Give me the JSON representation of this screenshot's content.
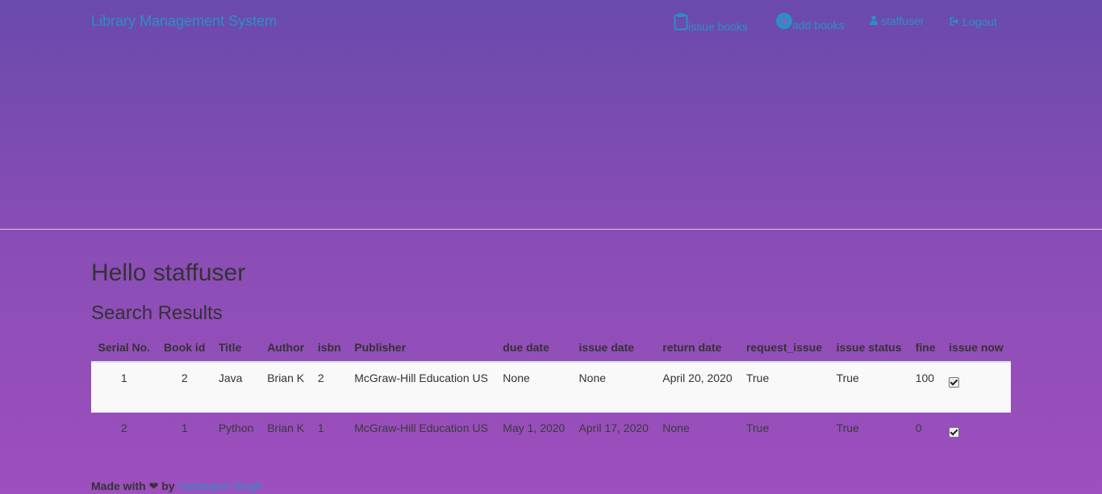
{
  "navbar": {
    "brand": "Library Management System",
    "issue_books": "issue books",
    "add_books": "add books",
    "user": "staffuser",
    "logout": "Logout"
  },
  "main": {
    "greeting": "Hello staffuser",
    "subtitle": "Search Results"
  },
  "table": {
    "headers": [
      "Serial No.",
      "Book id",
      "Title",
      "Author",
      "isbn",
      "Publisher",
      "due date",
      "issue date",
      "return date",
      "request_issue",
      "issue status",
      "fine",
      "issue now"
    ],
    "rows": [
      {
        "serial": "1",
        "book_id": "2",
        "title": "Java",
        "author": "Brian K",
        "isbn": "2",
        "publisher": "McGraw-Hill Education US",
        "due_date": "None",
        "issue_date": "None",
        "return_date": "April 20, 2020",
        "request_issue": "True",
        "issue_status": "True",
        "fine": "100",
        "issue_now": true
      },
      {
        "serial": "2",
        "book_id": "1",
        "title": "Python",
        "author": "Brian K",
        "isbn": "1",
        "publisher": "McGraw-Hill Education US",
        "due_date": "May 1, 2020",
        "issue_date": "April 17, 2020",
        "return_date": "None",
        "request_issue": "True",
        "issue_status": "True",
        "fine": "0",
        "issue_now": true
      }
    ]
  },
  "footer": {
    "made_with": "Made with",
    "heart": "❤",
    "by": "by",
    "author_link": "Vishavjeet Singh"
  },
  "icons": {
    "issue": "clipboard-icon",
    "add": "plus-circle-icon",
    "user": "user-icon",
    "logout": "logout-icon"
  },
  "colors": {
    "link": "#2a8fc6",
    "background_top": "#6a4aac",
    "background_bottom": "#9d4fbd"
  }
}
